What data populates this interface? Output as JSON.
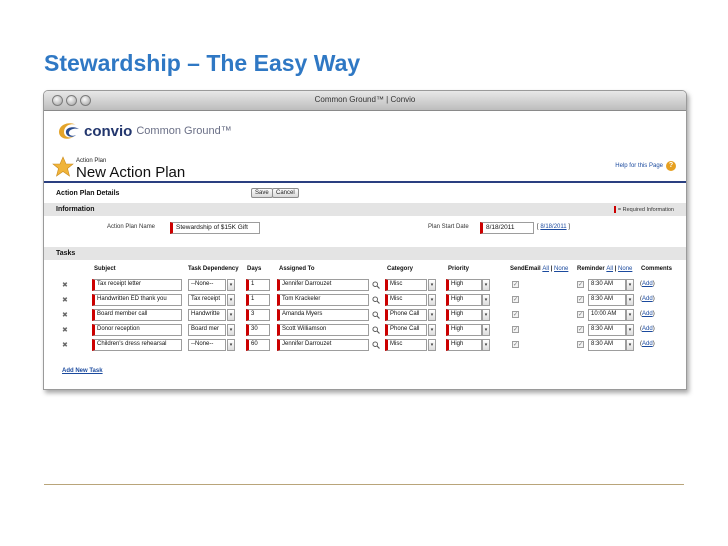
{
  "slide": {
    "title": "Stewardship – The Easy Way"
  },
  "window": {
    "title": "Common Ground™ | Convio"
  },
  "app": {
    "logo_text": "convio",
    "logo_sub": "Common Ground™",
    "help_link": "Help for this Page",
    "breadcrumb": "Action Plan",
    "page_title": "New Action Plan"
  },
  "details": {
    "title": "Action Plan Details",
    "save_label": "Save",
    "cancel_label": "Cancel"
  },
  "information": {
    "section_label": "Information",
    "required_note": "= Required Information",
    "plan_name_label": "Action Plan Name",
    "plan_name_value": "Stewardship of $15K Gift",
    "start_date_label": "Plan Start Date",
    "start_date_value": "8/18/2011",
    "start_date_link": "8/18/2011"
  },
  "tasks": {
    "section_label": "Tasks",
    "headers": {
      "subject": "Subject",
      "dependency": "Task Dependency",
      "days": "Days",
      "assigned": "Assigned To",
      "category": "Category",
      "priority": "Priority",
      "send_email": "SendEmail",
      "all": "All",
      "none": "None",
      "reminder": "Reminder",
      "comments": "Comments"
    },
    "rows": [
      {
        "subject": "Tax receipt letter",
        "dependency": "--None--",
        "days": "1",
        "assigned": "Jennifer Darrouzet",
        "category": "Misc",
        "priority": "High",
        "reminder": "8:30 AM",
        "add": "Add"
      },
      {
        "subject": "Handwritten ED thank you",
        "dependency": "Tax receipt",
        "days": "1",
        "assigned": "Tom Krackeler",
        "category": "Misc",
        "priority": "High",
        "reminder": "8:30 AM",
        "add": "Add"
      },
      {
        "subject": "Board member call",
        "dependency": "Handwritte",
        "days": "3",
        "assigned": "Amanda Myers",
        "category": "Phone Call",
        "priority": "High",
        "reminder": "10:00 AM",
        "add": "Add"
      },
      {
        "subject": "Donor reception",
        "dependency": "Board mer",
        "days": "30",
        "assigned": "Scott Williamson",
        "category": "Phone Call",
        "priority": "High",
        "reminder": "8:30 AM",
        "add": "Add"
      },
      {
        "subject": "Children's dress rehearsal",
        "dependency": "--None--",
        "days": "60",
        "assigned": "Jennifer Darrouzet",
        "category": "Misc",
        "priority": "High",
        "reminder": "8:30 AM",
        "add": "Add"
      }
    ],
    "add_new_task": "Add New Task"
  },
  "colors": {
    "title_blue": "#2f78c4",
    "required_red": "#cc0000",
    "link_blue": "#1b4a9e",
    "rule_gold": "#b9a57a"
  }
}
